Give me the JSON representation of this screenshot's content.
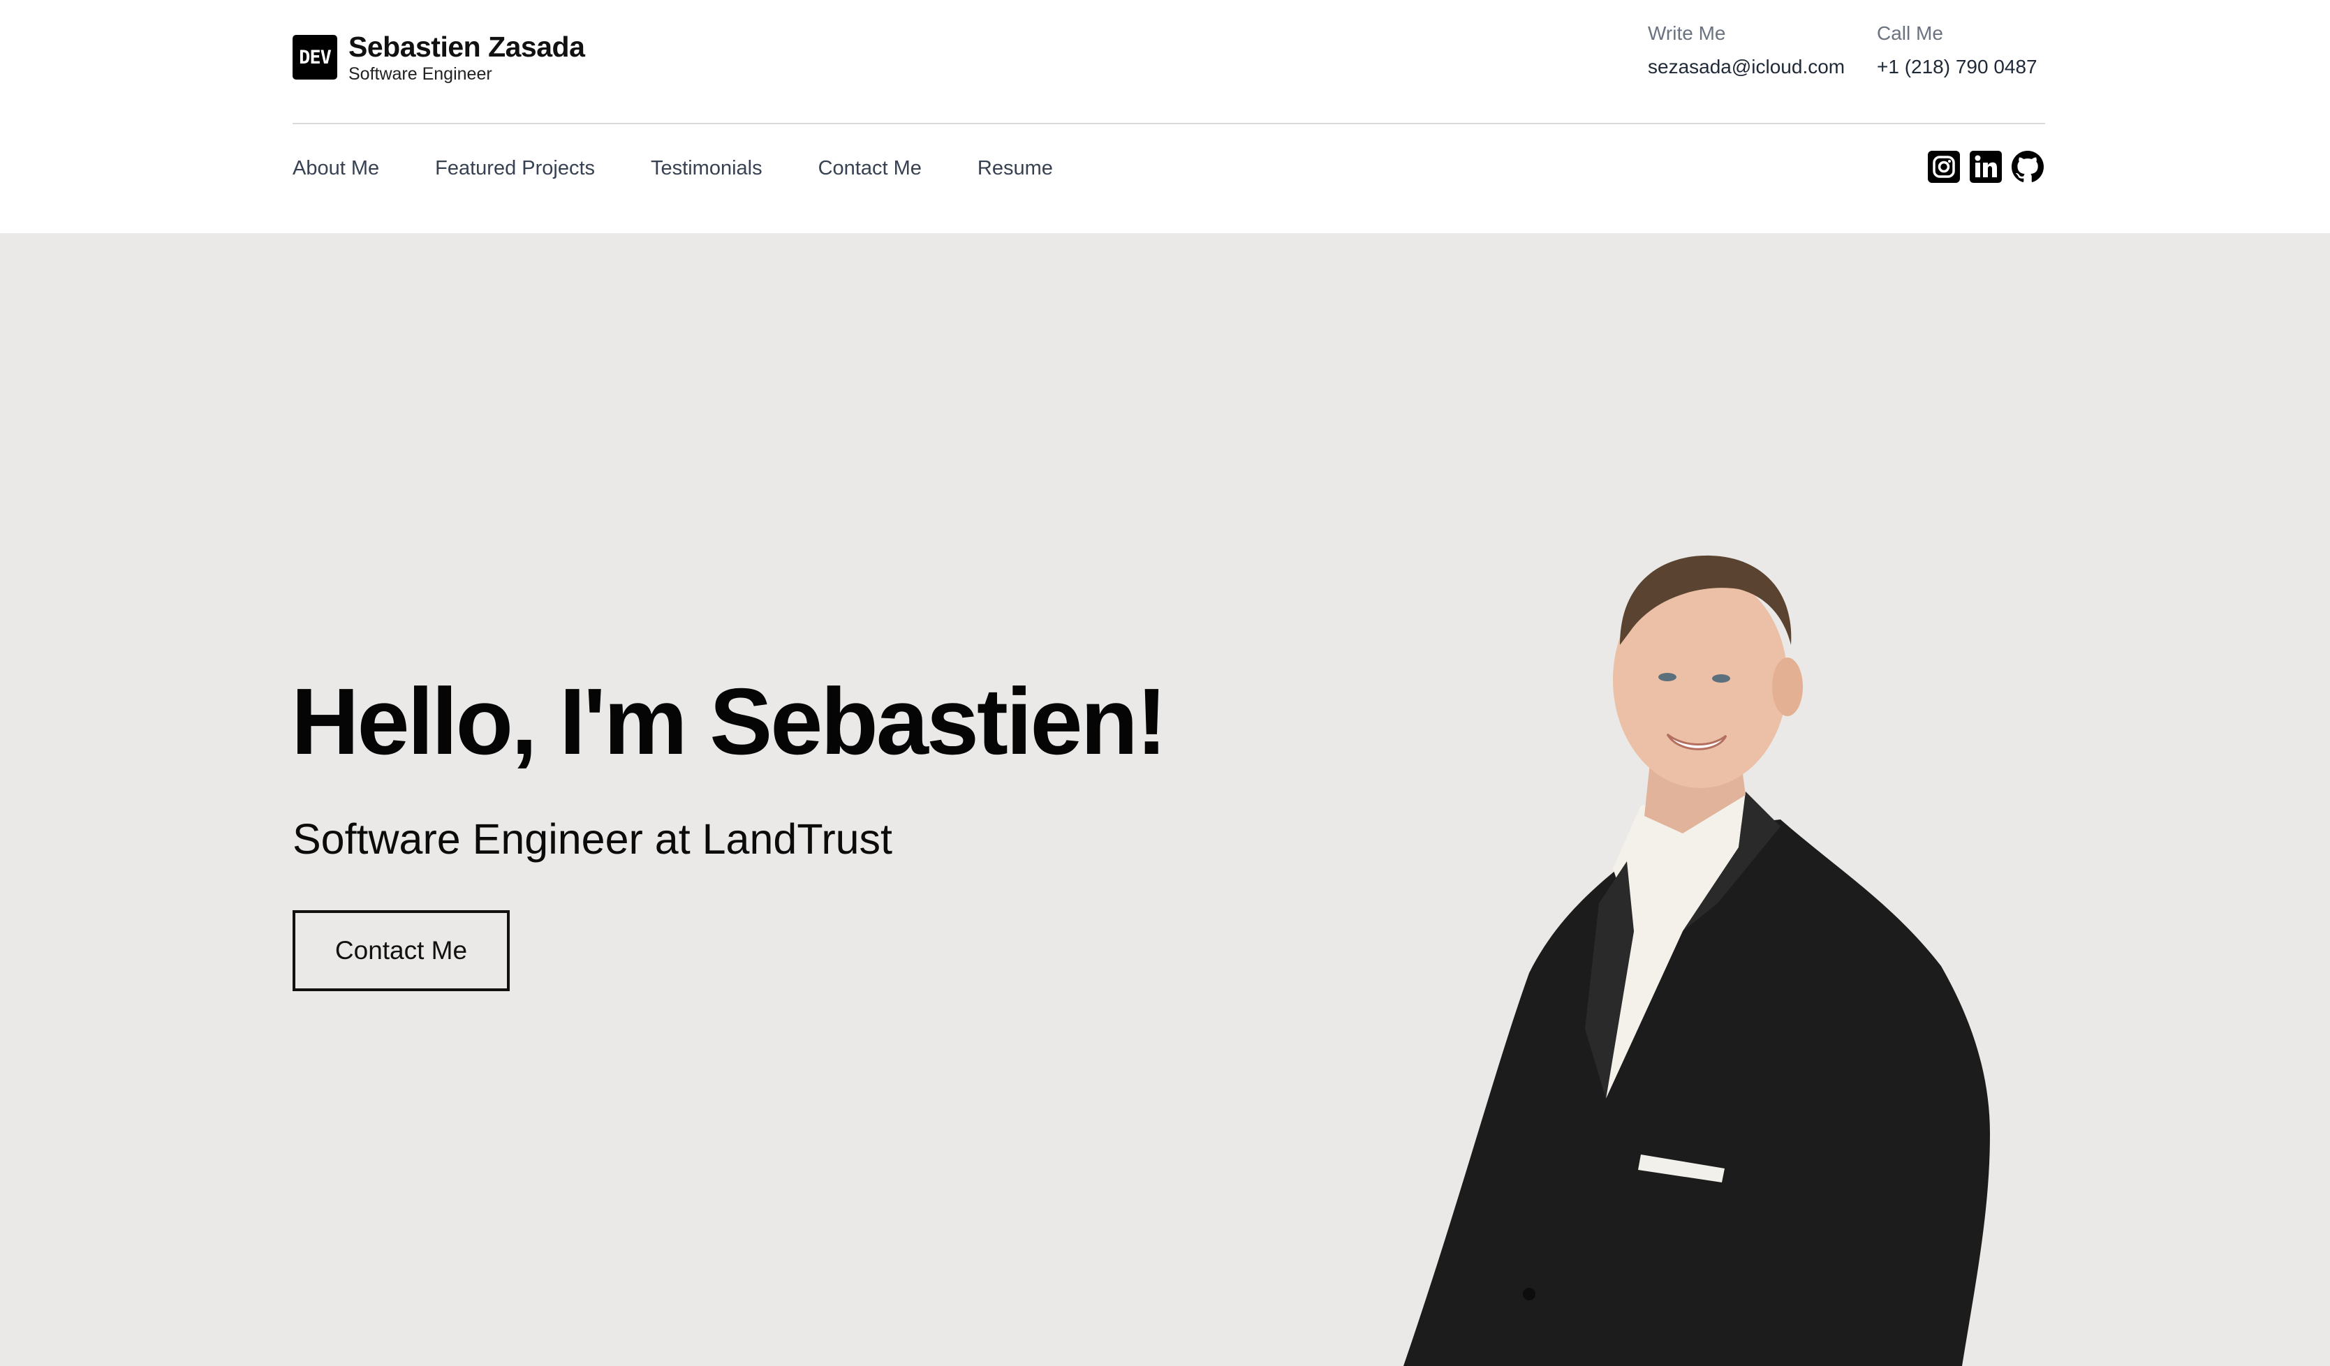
{
  "brand": {
    "logo_text": "DEV",
    "name": "Sebastien Zasada",
    "title": "Software Engineer"
  },
  "contact": {
    "email_label": "Write Me",
    "email_value": "sezasada@icloud.com",
    "phone_label": "Call Me",
    "phone_value": "+1 (218) 790 0487"
  },
  "nav": {
    "items": [
      {
        "label": "About Me"
      },
      {
        "label": "Featured Projects"
      },
      {
        "label": "Testimonials"
      },
      {
        "label": "Contact Me"
      },
      {
        "label": "Resume"
      }
    ]
  },
  "socials": [
    {
      "icon": "instagram-icon"
    },
    {
      "icon": "linkedin-icon"
    },
    {
      "icon": "github-icon"
    }
  ],
  "hero": {
    "heading": "Hello, I'm Sebastien!",
    "subheading": "Software Engineer at LandTrust",
    "cta_label": "Contact Me"
  },
  "colors": {
    "hero_background": "#eae9e7",
    "text_primary": "#111111",
    "text_muted": "#6b7280",
    "divider": "#d9d9d9"
  }
}
